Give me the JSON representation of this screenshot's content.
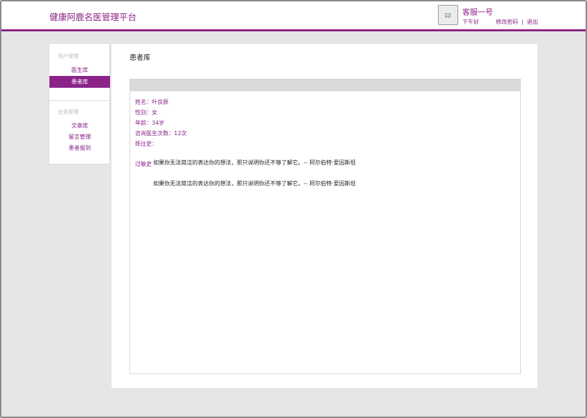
{
  "header": {
    "brand": "健康阿鹿名医管理平台",
    "user": {
      "name": "客服一号",
      "greeting": "下午好",
      "change_password": "修改密码",
      "separator": "|",
      "logout": "退出"
    }
  },
  "sidebar": {
    "groups": [
      {
        "title": "用户管理",
        "items": [
          {
            "label": "医生库",
            "active": false
          },
          {
            "label": "患者库",
            "active": true
          }
        ]
      },
      {
        "title": "业务管理",
        "items": [
          {
            "label": "文章库",
            "active": false
          },
          {
            "label": "留言管理",
            "active": false
          },
          {
            "label": "患者报到",
            "active": false
          }
        ]
      }
    ]
  },
  "main": {
    "title": "患者库",
    "patient": {
      "name": "姓名：叶良辰",
      "gender": "性别：女",
      "age": "年龄：34岁",
      "consult_count": "咨询医生次数：12次",
      "history": "既往史：",
      "allergy_label": "过敏史",
      "quotes": [
        "如果你无法简洁的表达你的想法，那只说明你还不够了解它。-- 阿尔伯特·爱因斯坦",
        "如果你无法简洁的表达你的想法，那只说明你还不够了解它。-- 阿尔伯特·爱因斯坦"
      ]
    }
  },
  "colors": {
    "accent": "#8b2388",
    "background": "#e6e6e6"
  }
}
